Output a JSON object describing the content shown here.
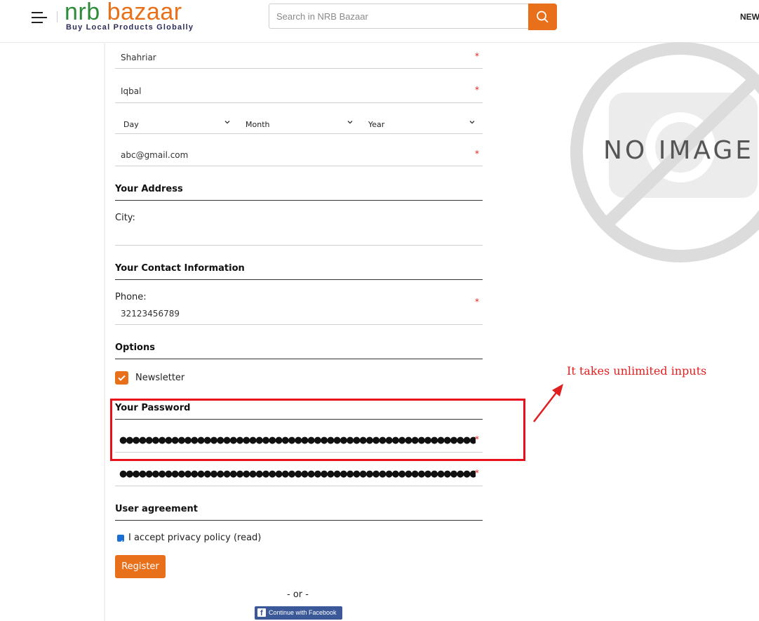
{
  "header": {
    "logo_brand_left": "nrb",
    "logo_brand_right": "bazaar",
    "logo_tagline": "Buy Local Products Globally",
    "search_placeholder": "Search in NRB Bazaar",
    "right_link": "NEW"
  },
  "form": {
    "first_name": "Shahriar",
    "last_name": "Iqbal",
    "dob": {
      "day": "Day",
      "month": "Month",
      "year": "Year"
    },
    "email": "abc@gmail.com",
    "required_mark": "*",
    "address_title": "Your Address",
    "city_label": "City:",
    "contact_title": "Your Contact Information",
    "phone_label": "Phone:",
    "phone_value": "32123456789",
    "options_title": "Options",
    "newsletter_label": "Newsletter",
    "newsletter_checked": true,
    "password_title": "Your Password",
    "password_mask": "●●●●●●●●●●●●●●●●●●●●●●●●●●●●●●●●●●●●●●●●●●●●●●●●●●●●●●●●●●●●●●●●●●●●●●●●●●●●●",
    "confirm_mask": "●●●●●●●●●●●●●●●●●●●●●●●●●●●●●●●●●●●●●●●●●●●●●●●●●●●●●●●●●●●●●●●●●●●●●●●●●●●●●",
    "agreement_title": "User agreement",
    "privacy_label": "I accept privacy policy (read)",
    "privacy_checked": true,
    "register_label": "Register",
    "or_text": "- or -",
    "facebook_label": "Continue with Facebook"
  },
  "annotation": {
    "note": "It takes unlimited inputs",
    "color": "#e02020"
  },
  "placeholder_image": {
    "text": "NO IMAGE"
  },
  "colors": {
    "accent": "#e8701a",
    "brand_green": "#2e8b3a",
    "facebook": "#3b5998"
  }
}
